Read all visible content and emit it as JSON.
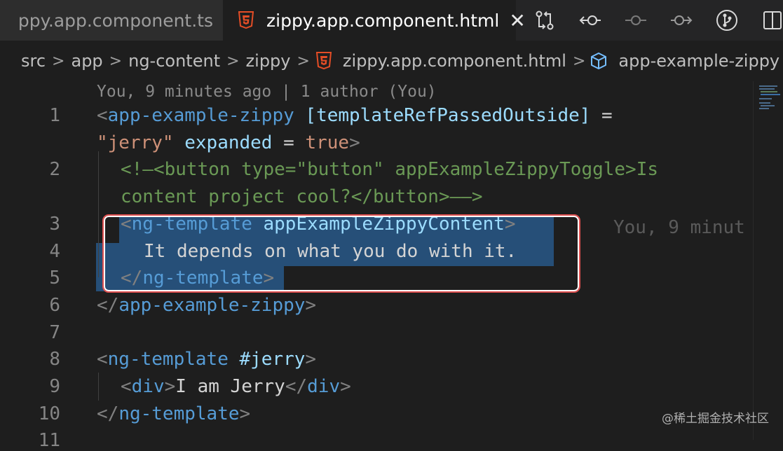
{
  "tabs": {
    "inactive_label": "ppy.app.component.ts",
    "active_label": "zippy.app.component.html",
    "close_glyph": "✕"
  },
  "toolbar": {
    "icons": [
      "compare-changes-icon",
      "go-back-icon",
      "commit-icon",
      "go-forward-icon",
      "git-branch-icon",
      "split-editor-icon"
    ]
  },
  "breadcrumb": {
    "items": [
      "src",
      "app",
      "ng-content",
      "zippy",
      "zippy.app.component.html",
      "app-example-zippy"
    ],
    "separator": ">"
  },
  "editor": {
    "blame_header": "You, 9 minutes ago | 1 author (You)",
    "inline_blame": "You, 9 minut",
    "line_numbers": [
      "1",
      "2",
      "3",
      "4",
      "5",
      "6",
      "7",
      "8",
      "9",
      "10",
      "11"
    ],
    "lines": {
      "l1a_open": "<",
      "l1a_tag": "app-example-zippy",
      "l1a_attr": " [templateRefPassedOutside]",
      "l1a_eq": " =",
      "l1b_str": "\"jerry\"",
      "l1b_attr": " expanded",
      "l1b_eq": " = ",
      "l1b_val": "true",
      "l1b_close": ">",
      "l2a": "<!—<button type=\"button\" appExampleZippyToggle>Is",
      "l2b": "content project cool?</button>——>",
      "l3_open": "<",
      "l3_tag": "ng-template",
      "l3_attr": " appExampleZippyContent",
      "l3_close": ">",
      "l4_text": "It depends on what you do with it.",
      "l5_open": "</",
      "l5_tag": "ng-template",
      "l5_close": ">",
      "l6_open": "</",
      "l6_tag": "app-example-zippy",
      "l6_close": ">",
      "l8_open": "<",
      "l8_tag": "ng-template",
      "l8_attr": " #jerry",
      "l8_close": ">",
      "l9_open": "<",
      "l9_tag": "div",
      "l9_close": ">",
      "l9_text": "I am Jerry",
      "l9_open2": "</",
      "l9_tag2": "div",
      "l9_close2": ">",
      "l10_open": "</",
      "l10_tag": "ng-template",
      "l10_close": ">"
    }
  },
  "watermark": "@稀土掘金技术社区",
  "colors": {
    "tag": "#569cd6",
    "attr": "#9cdcfe",
    "string": "#ce9178",
    "comment": "#6a9955",
    "selection": "#264f78",
    "html5_icon": "#e44d26",
    "highlight_border": "#e05050"
  }
}
